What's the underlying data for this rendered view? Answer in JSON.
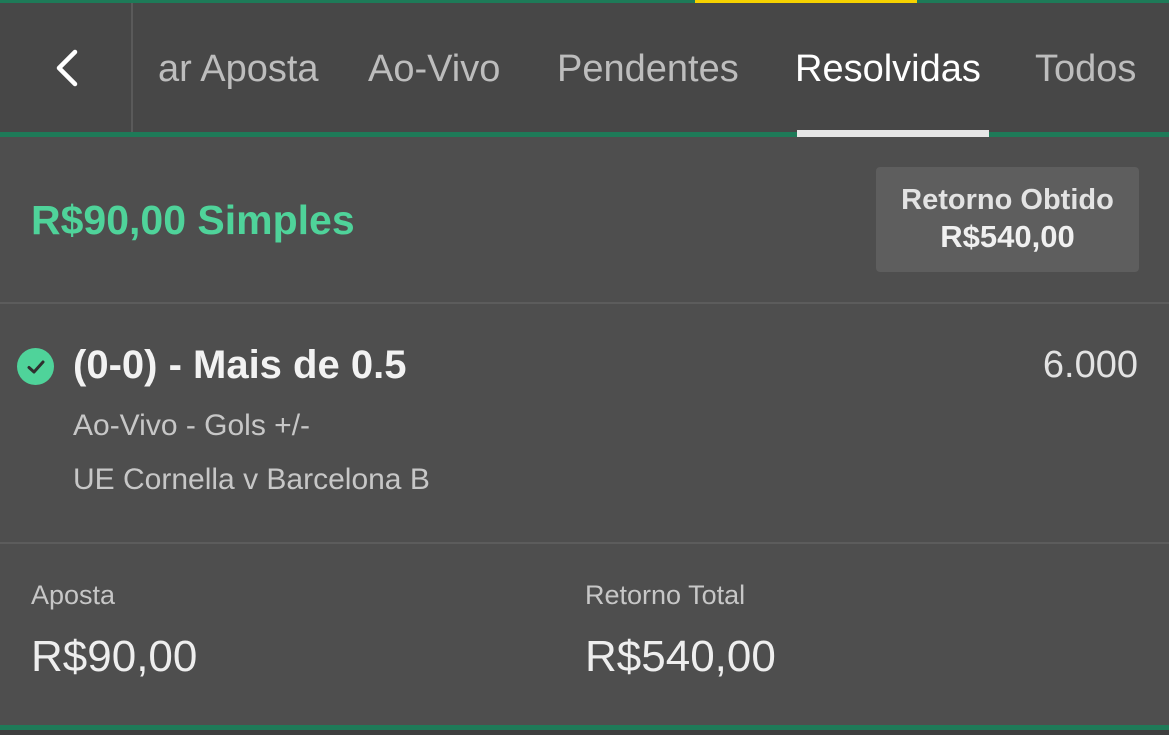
{
  "tabs": [
    {
      "label": "ar Aposta",
      "active": false
    },
    {
      "label": "Ao-Vivo",
      "active": false
    },
    {
      "label": "Pendentes",
      "active": false
    },
    {
      "label": "Resolvidas",
      "active": true
    },
    {
      "label": "Todos",
      "active": false
    }
  ],
  "bet": {
    "title": "R$90,00 Simples",
    "return_label": "Retorno Obtido",
    "return_value": "R$540,00"
  },
  "selection": {
    "status": "won",
    "name": "(0-0) - Mais de 0.5",
    "odds": "6.000",
    "market": "Ao-Vivo - Gols +/-",
    "event": "UE Cornella v Barcelona B"
  },
  "totals": {
    "stake_label": "Aposta",
    "stake_value": "R$90,00",
    "return_label": "Retorno Total",
    "return_value": "R$540,00"
  },
  "colors": {
    "accent_green": "#4fd39a",
    "brand_green": "#1e7a58",
    "highlight_yellow": "#f6d200"
  },
  "icons": {
    "back": "chevron-left-icon",
    "status": "check-circle-icon"
  }
}
